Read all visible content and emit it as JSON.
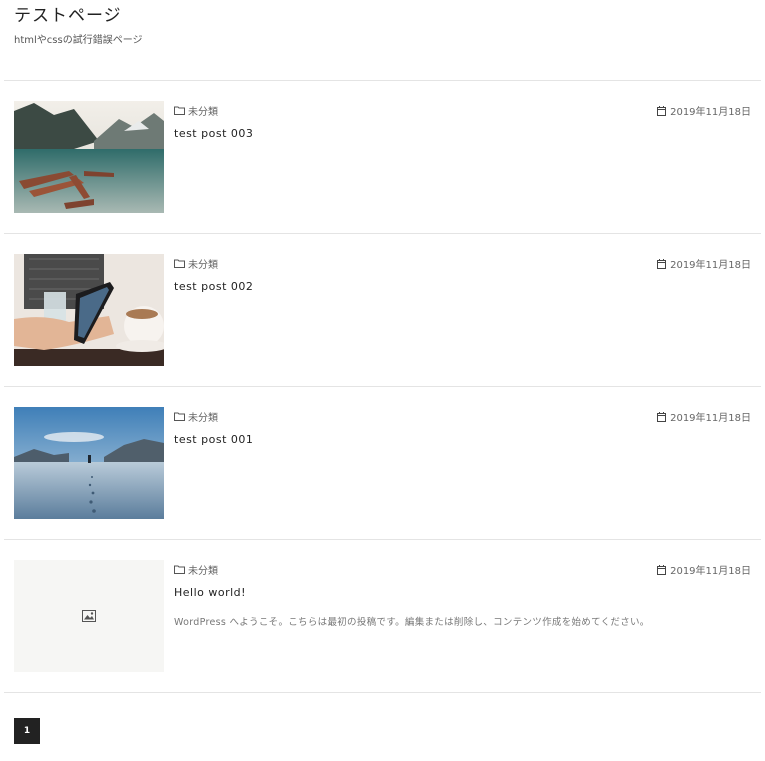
{
  "site": {
    "title": "テストページ",
    "description": "htmlやcssの試行錯誤ページ"
  },
  "posts": [
    {
      "category": "未分類",
      "date": "2019年11月18日",
      "title": "test post 003",
      "excerpt": "",
      "thumbnail": "lake-boats"
    },
    {
      "category": "未分類",
      "date": "2019年11月18日",
      "title": "test post 002",
      "excerpt": "",
      "thumbnail": "phone-coffee"
    },
    {
      "category": "未分類",
      "date": "2019年11月18日",
      "title": "test post 001",
      "excerpt": "",
      "thumbnail": "snow-field"
    },
    {
      "category": "未分類",
      "date": "2019年11月18日",
      "title": "Hello world!",
      "excerpt": "WordPress へようこそ。こちらは最初の投稿です。編集または削除し、コンテンツ作成を始めてください。",
      "thumbnail": "placeholder"
    }
  ],
  "pagination": {
    "current": "1"
  },
  "icons": {
    "category": "folder-icon",
    "date": "calendar-icon",
    "placeholder": "image-icon"
  }
}
